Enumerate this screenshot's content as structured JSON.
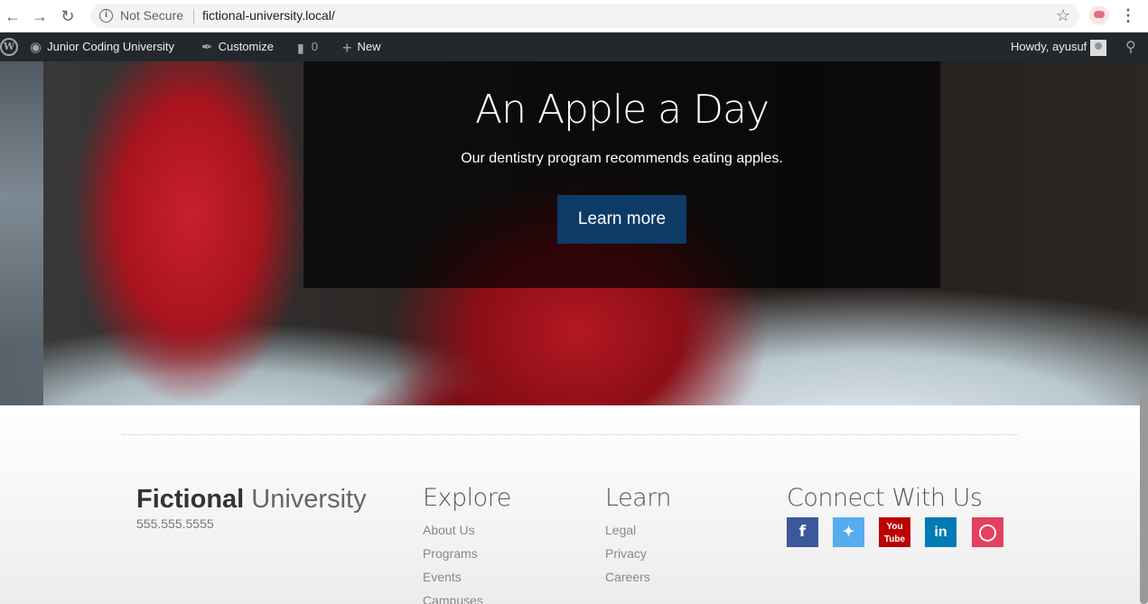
{
  "browser": {
    "security_label": "Not Secure",
    "url": "fictional-university.local/"
  },
  "admin_bar": {
    "site_name": "Junior Coding University",
    "customize": "Customize",
    "comments_count": "0",
    "new_label": "New",
    "greeting": "Howdy, ayusuf"
  },
  "hero": {
    "title": "An Apple a Day",
    "subtitle": "Our dentistry program recommends eating apples.",
    "button": "Learn more"
  },
  "footer": {
    "brand_bold": "Fictional",
    "brand_light": " University",
    "phone": "555.555.5555",
    "explore": {
      "heading": "Explore",
      "links": [
        "About Us",
        "Programs",
        "Events",
        "Campuses"
      ]
    },
    "learn": {
      "heading": "Learn",
      "links": [
        "Legal",
        "Privacy",
        "Careers"
      ]
    },
    "connect": {
      "heading": "Connect With Us",
      "icons": [
        "facebook-icon",
        "twitter-icon",
        "youtube-icon",
        "linkedin-icon",
        "instagram-icon"
      ],
      "colors": {
        "facebook": "#3b5998",
        "twitter": "#55acee",
        "youtube": "#bb0000",
        "linkedin": "#007bb5",
        "instagram": "#e4405f"
      }
    }
  },
  "colors": {
    "admin_bar": "#23282d",
    "button": "#0d3b66"
  }
}
